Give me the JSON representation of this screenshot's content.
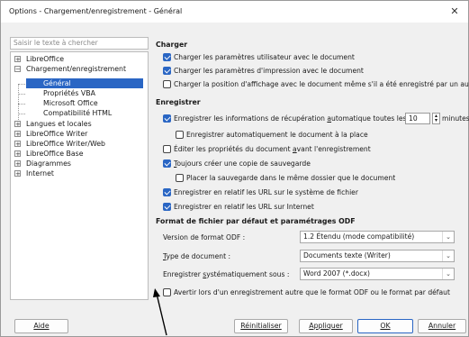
{
  "window": {
    "title": "Options - Chargement/enregistrement - Général"
  },
  "search": {
    "placeholder": "Saisir le texte à chercher"
  },
  "tree": {
    "items": [
      {
        "label": "LibreOffice",
        "expander": "+"
      },
      {
        "label": "Chargement/enregistrement",
        "expander": "−"
      },
      {
        "label": "Général"
      },
      {
        "label": "Propriétés VBA"
      },
      {
        "label": "Microsoft Office"
      },
      {
        "label": "Compatibilité HTML"
      },
      {
        "label": "Langues et locales",
        "expander": "+"
      },
      {
        "label": "LibreOffice Writer",
        "expander": "+"
      },
      {
        "label": "LibreOffice Writer/Web",
        "expander": "+"
      },
      {
        "label": "LibreOffice Base",
        "expander": "+"
      },
      {
        "label": "Diagrammes",
        "expander": "+"
      },
      {
        "label": "Internet",
        "expander": "+"
      }
    ]
  },
  "charger": {
    "heading": "Charger",
    "opt1": "Charger les paramètres utilisateur avec le document",
    "opt2": "Charger les paramètres d'impression avec le document",
    "opt3": "Charger la position d'affichage avec le document même s'il a été enregistré par un auti"
  },
  "enregistrer": {
    "heading": "Enregistrer",
    "opt1_pre": "Enregistrer les informations de récupération ",
    "opt1_u": "a",
    "opt1_post": "utomatique toutes les",
    "interval": "10",
    "minutes": "minutes",
    "opt2": "Enregistrer automatiquement le document à la place",
    "opt3_pre": "Éditer les propriétés du document ",
    "opt3_u": "a",
    "opt3_post": "vant l'enregistrement",
    "opt4_u": "T",
    "opt4_post": "oujours créer une copie de sauvegarde",
    "opt5": "Placer la sauvegarde dans le même dossier que le document",
    "opt6": "Enregistrer en relatif les URL sur le système de fichier",
    "opt7": "Enregistrer en relatif les URL sur Internet"
  },
  "format": {
    "heading": "Format de fichier par défaut et paramétrages ODF",
    "version_label": "Version de format ODF :",
    "version_value": "1.2 Étendu (mode compatibilité)",
    "type_u": "T",
    "type_label": "ype de document :",
    "type_value": "Documents texte (Writer)",
    "save_pre": "Enregistrer ",
    "save_u": "s",
    "save_post": "ystématiquement sous :",
    "save_value": "Word 2007 (*.docx)",
    "warn": "Avertir lors d'un enregistrement autre que le format ODF ou le format par défaut"
  },
  "buttons": {
    "help": "Aide",
    "reset": "Réinitialiser",
    "apply": "Appliquer",
    "ok": "OK",
    "cancel": "Annuler"
  },
  "colors": {
    "accent": "#2a66c4"
  }
}
